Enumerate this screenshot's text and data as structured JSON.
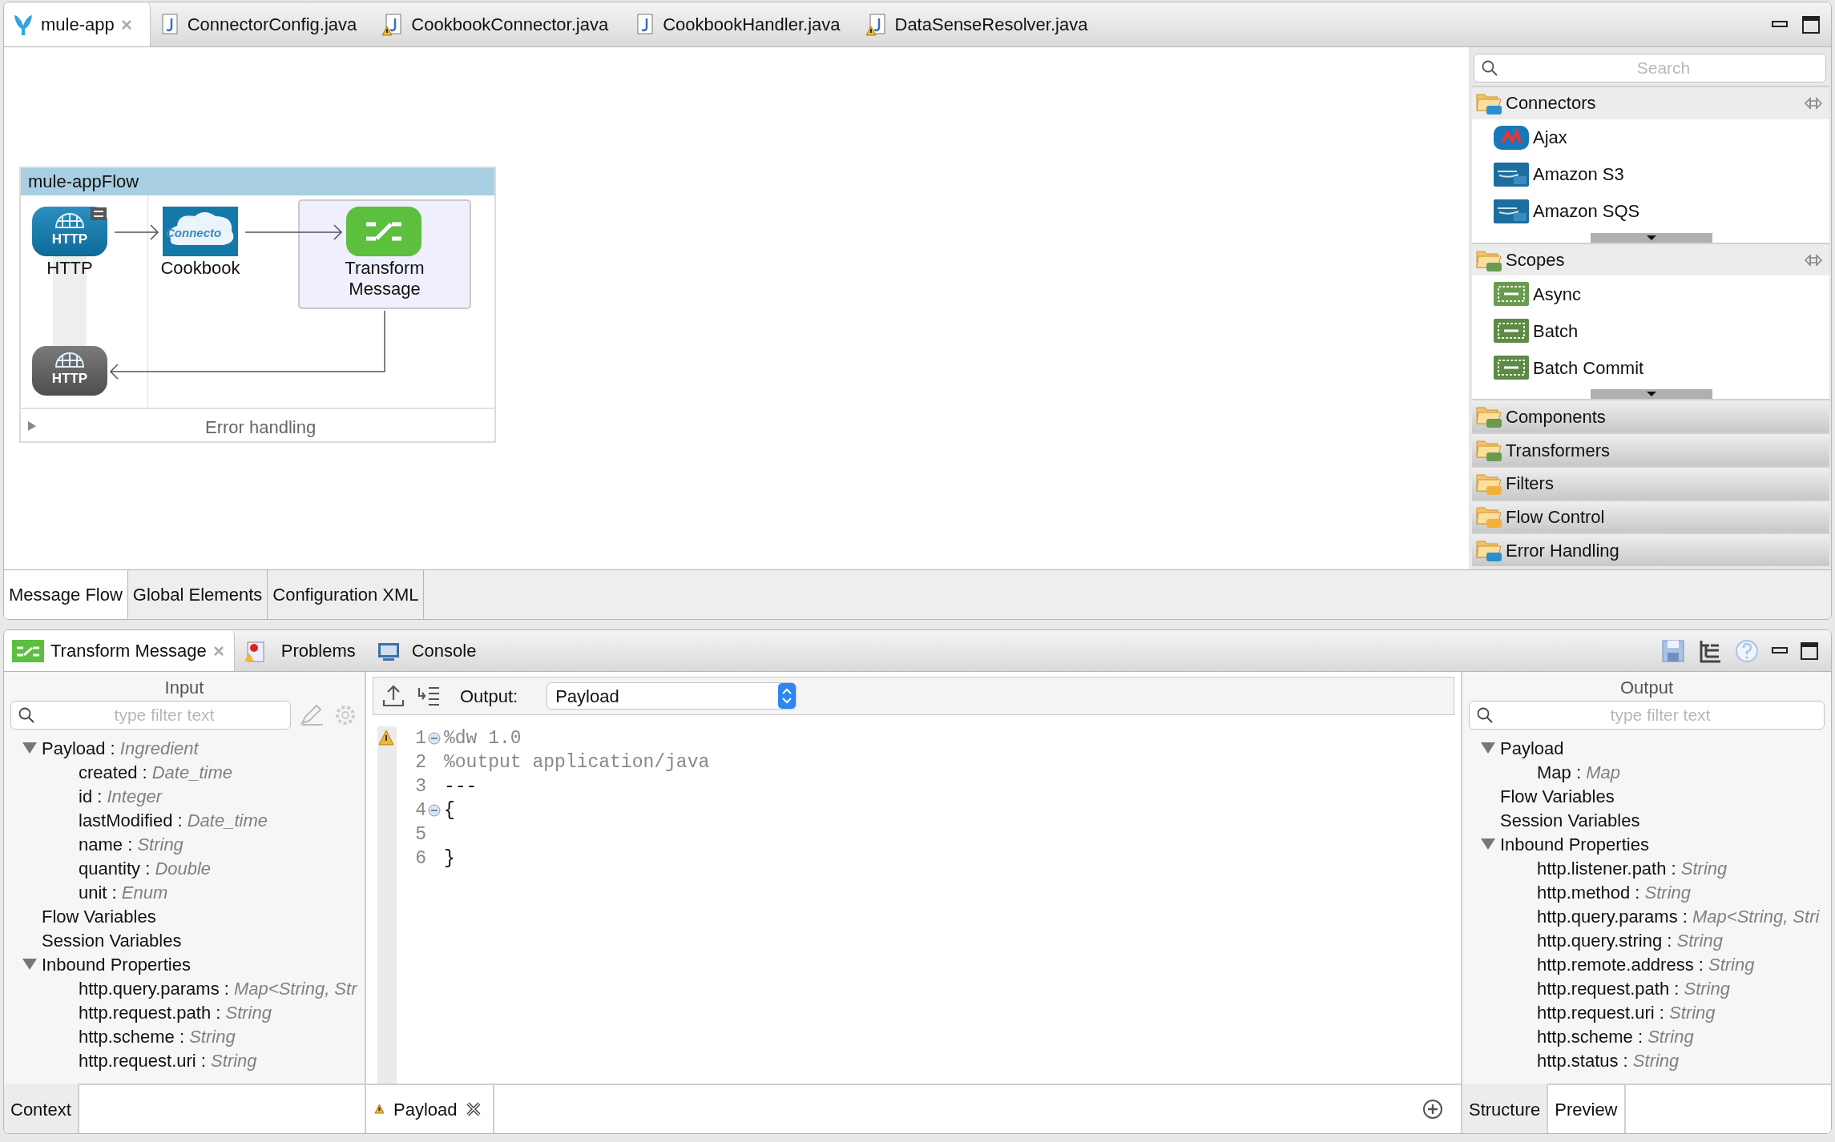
{
  "editor_tabs": [
    {
      "label": "mule-app",
      "kind": "mule",
      "selected": true,
      "closable": true
    },
    {
      "label": "ConnectorConfig.java",
      "kind": "java",
      "selected": false,
      "closable": false
    },
    {
      "label": "CookbookConnector.java",
      "kind": "java-warning",
      "selected": false,
      "closable": false
    },
    {
      "label": "CookbookHandler.java",
      "kind": "java",
      "selected": false,
      "closable": false
    },
    {
      "label": "DataSenseResolver.java",
      "kind": "java-warning",
      "selected": false,
      "closable": false
    }
  ],
  "flow": {
    "title": "mule-appFlow",
    "nodes": [
      {
        "label": "HTTP",
        "kind": "http",
        "icon_text": "HTTP",
        "selected": false
      },
      {
        "label": "Cookbook",
        "kind": "connector",
        "icon_text": "Connecto",
        "selected": false
      },
      {
        "label": "Transform Message",
        "kind": "transform",
        "selected": true
      }
    ],
    "response": {
      "kind": "http",
      "icon_text": "HTTP"
    },
    "error_handling": {
      "label": "Error handling",
      "expanded": false
    }
  },
  "palette": {
    "placeholder": "Search",
    "categories": [
      {
        "label": "Connectors",
        "kind": "connector",
        "expanded": true,
        "items": [
          {
            "label": "Ajax",
            "kind": "ajax"
          },
          {
            "label": "Amazon S3",
            "kind": "amazon"
          },
          {
            "label": "Amazon SQS",
            "kind": "amazon"
          }
        ]
      },
      {
        "label": "Scopes",
        "kind": "scope",
        "expanded": true,
        "items": [
          {
            "label": "Async",
            "kind": "async"
          },
          {
            "label": "Batch",
            "kind": "batch"
          },
          {
            "label": "Batch Commit",
            "kind": "commit"
          }
        ]
      },
      {
        "label": "Components",
        "kind": "component",
        "expanded": false
      },
      {
        "label": "Transformers",
        "kind": "transformer",
        "expanded": false
      },
      {
        "label": "Filters",
        "kind": "filter",
        "expanded": false
      },
      {
        "label": "Flow Control",
        "kind": "router",
        "expanded": false
      },
      {
        "label": "Error Handling",
        "kind": "exception",
        "expanded": false
      }
    ]
  },
  "canvas_tabs": [
    {
      "label": "Message Flow",
      "selected": true
    },
    {
      "label": "Global Elements",
      "selected": false
    },
    {
      "label": "Configuration XML",
      "selected": false
    }
  ],
  "view_tabs": [
    {
      "label": "Transform Message",
      "kind": "transform",
      "selected": true,
      "closable": true
    },
    {
      "label": "Problems",
      "kind": "problems",
      "selected": false,
      "closable": false
    },
    {
      "label": "Console",
      "kind": "console",
      "selected": false,
      "closable": false
    }
  ],
  "input": {
    "title": "Input",
    "placeholder": "type filter text",
    "tree": [
      {
        "label": "Payload : *Ingredient*",
        "expanded": true,
        "children": [
          {
            "label": "created : *Date_time*"
          },
          {
            "label": "id : *Integer*"
          },
          {
            "label": "lastModified : *Date_time*"
          },
          {
            "label": "name : *String*"
          },
          {
            "label": "quantity : *Double*"
          },
          {
            "label": "unit : *Enum*"
          }
        ]
      },
      {
        "label": "Flow Variables"
      },
      {
        "label": "Session Variables"
      },
      {
        "label": "Inbound Properties",
        "expanded": true,
        "children": [
          {
            "label": "http.query.params : *Map<String, Str*"
          },
          {
            "label": "http.request.path : *String*"
          },
          {
            "label": "http.scheme : *String*"
          },
          {
            "label": "http.request.uri : *String*"
          }
        ]
      }
    ],
    "tabs": [
      {
        "label": "Context",
        "selected": true
      }
    ]
  },
  "editor": {
    "output_label": "Output:",
    "output_value": "Payload",
    "lines": [
      {
        "number": "1",
        "text": "%dw 1.0",
        "kind": "directive",
        "foldable": true,
        "warning": true
      },
      {
        "number": "2",
        "text": "%output application/java",
        "kind": "directive",
        "foldable": false,
        "warning": false
      },
      {
        "number": "3",
        "text": "---",
        "kind": "code",
        "foldable": false,
        "warning": false
      },
      {
        "number": "4",
        "text": "{",
        "kind": "code",
        "foldable": true,
        "warning": false
      },
      {
        "number": "5",
        "foldable": false,
        "warning": false
      },
      {
        "number": "6",
        "text": "}",
        "kind": "code",
        "foldable": false,
        "warning": false
      }
    ],
    "tabs": [
      {
        "label": "Payload",
        "selected": true,
        "warning": true
      }
    ]
  },
  "output": {
    "title": "Output",
    "placeholder": "type filter text",
    "tree": [
      {
        "label": "Payload",
        "expanded": true,
        "children": [
          {
            "label": "Map : *Map*"
          }
        ]
      },
      {
        "label": "Flow Variables"
      },
      {
        "label": "Session Variables"
      },
      {
        "label": "Inbound Properties",
        "expanded": true,
        "children": [
          {
            "label": "http.listener.path : *String*"
          },
          {
            "label": "http.method : *String*"
          },
          {
            "label": "http.query.params : *Map<String, Stri*"
          },
          {
            "label": "http.query.string : *String*"
          },
          {
            "label": "http.remote.address : *String*"
          },
          {
            "label": "http.request.path : *String*"
          },
          {
            "label": "http.request.uri : *String*"
          },
          {
            "label": "http.scheme : *String*"
          },
          {
            "label": "http.status : *String*"
          }
        ]
      }
    ],
    "tabs": [
      {
        "label": "Structure",
        "selected": true
      },
      {
        "label": "Preview",
        "selected": false
      }
    ]
  }
}
